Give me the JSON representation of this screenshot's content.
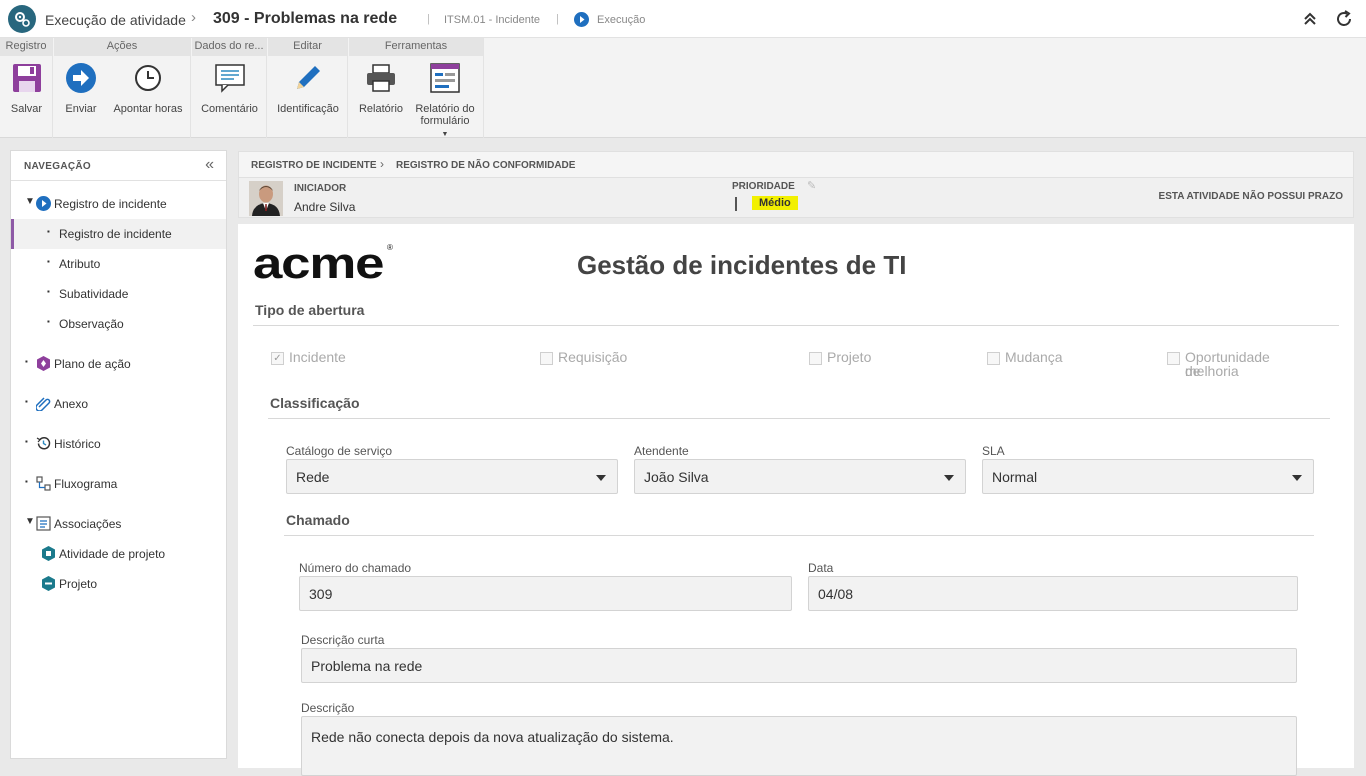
{
  "topbar": {
    "app_title": "Execução de atividade",
    "record_title": "309 - Problemas na rede",
    "process_code": "ITSM.01 - Incidente",
    "status": "Execução"
  },
  "ribbon": {
    "groups": [
      {
        "label": "Registro",
        "buttons": [
          {
            "label": "Salvar"
          }
        ]
      },
      {
        "label": "Ações",
        "buttons": [
          {
            "label": "Enviar"
          },
          {
            "label": "Apontar horas"
          }
        ]
      },
      {
        "label": "Dados do re...",
        "buttons": [
          {
            "label": "Comentário"
          }
        ]
      },
      {
        "label": "Editar",
        "buttons": [
          {
            "label": "Identificação"
          }
        ]
      },
      {
        "label": "Ferramentas",
        "buttons": [
          {
            "label": "Relatório"
          },
          {
            "label": "Relatório do formulário"
          }
        ]
      }
    ]
  },
  "nav": {
    "title": "NAVEGAÇÃO",
    "items": [
      {
        "label": "Registro de incidente"
      },
      {
        "label": "Registro de incidente"
      },
      {
        "label": "Atributo"
      },
      {
        "label": "Subatividade"
      },
      {
        "label": "Observação"
      },
      {
        "label": "Plano de ação"
      },
      {
        "label": "Anexo"
      },
      {
        "label": "Histórico"
      },
      {
        "label": "Fluxograma"
      },
      {
        "label": "Associações"
      },
      {
        "label": "Atividade de projeto"
      },
      {
        "label": "Projeto"
      }
    ]
  },
  "breadcrumb": {
    "first": "REGISTRO DE INCIDENTE",
    "second": "REGISTRO DE NÃO CONFORMIDADE"
  },
  "info": {
    "initiator_label": "INICIADOR",
    "initiator_name": "Andre Silva",
    "priority_label": "PRIORIDADE",
    "priority_value": "Médio",
    "priority_color": "#f2f000",
    "deadline": "ESTA ATIVIDADE NÃO POSSUI PRAZO"
  },
  "form": {
    "logo": "acme",
    "logo_mark": "®",
    "title": "Gestão de incidentes de TI",
    "opening_type": {
      "label": "Tipo de abertura",
      "options": [
        {
          "label": "Incidente",
          "checked": true
        },
        {
          "label": "Requisição",
          "checked": false
        },
        {
          "label": "Projeto",
          "checked": false
        },
        {
          "label": "Mudança",
          "checked": false
        },
        {
          "label": "Oportunidade de",
          "label2": "melhoria",
          "checked": false
        }
      ]
    },
    "classification": {
      "label": "Classificação",
      "service_catalog": {
        "label": "Catálogo de serviço",
        "value": "Rede"
      },
      "attendant": {
        "label": "Atendente",
        "value": "João Silva"
      },
      "sla": {
        "label": "SLA",
        "value": "Normal"
      }
    },
    "ticket": {
      "label": "Chamado",
      "number": {
        "label": "Número do chamado",
        "value": "309"
      },
      "date": {
        "label": "Data",
        "value": "04/08"
      },
      "short_description": {
        "label": "Descrição curta",
        "value": "Problema na rede"
      },
      "description": {
        "label": "Descrição",
        "value": "Rede não conecta depois da nova atualização do sistema."
      }
    }
  }
}
